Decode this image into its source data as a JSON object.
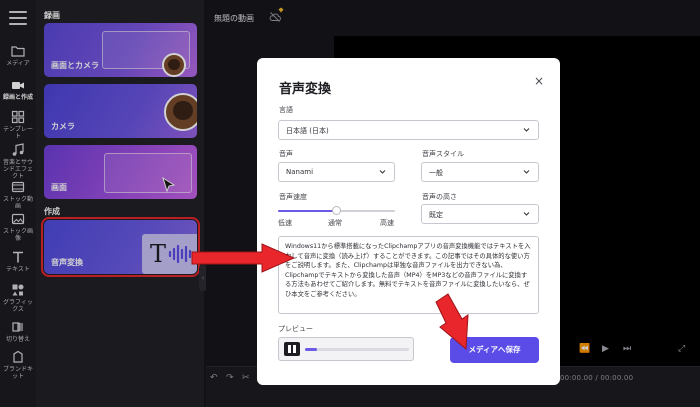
{
  "rail": {
    "items": [
      {
        "label": "メディア"
      },
      {
        "label": "録画と作成"
      },
      {
        "label": "テンプレー\nト"
      },
      {
        "label": "音楽とサウ\nンドエフェ\nクト"
      },
      {
        "label": "ストック動\n画"
      },
      {
        "label": "ストック画\n像"
      },
      {
        "label": "テキスト"
      },
      {
        "label": "グラフィッ\nクス"
      },
      {
        "label": "切り替え"
      },
      {
        "label": "ブランドキ\nット"
      }
    ]
  },
  "panel": {
    "section_record": "録画",
    "section_create": "作成",
    "cards": [
      {
        "label": "画面とカメラ"
      },
      {
        "label": "カメラ"
      },
      {
        "label": "画面"
      },
      {
        "label": "音声変換"
      }
    ]
  },
  "editor": {
    "project_title": "無題の動画",
    "timecode": "00:00.00 / 00:00.00"
  },
  "modal": {
    "title": "音声変換",
    "close": "×",
    "language_label": "言語",
    "language_value": "日本語 (日本)",
    "voice_label": "音声",
    "voice_value": "Nanami",
    "style_label": "音声スタイル",
    "style_value": "一般",
    "speed_label": "音声速度",
    "speed_ticks": [
      "低速",
      "通常",
      "高速"
    ],
    "speed_level": 0.5,
    "pitch_label": "音声の高さ",
    "pitch_value": "既定",
    "text": "Windows11から標準搭載になったClipchampアプリの音声変換機能ではテキストを入力して音声に変換（読み上げ）することができます。この記事ではその具体的な使い方をご説明します。また、Clipchampは単独な音声ファイルを出力できない為、Clipchampでテキストから変換した音声（MP4）をMP3などの音声ファイルに変換する方法もあわせてご紹介します。無料でテキストを音声ファイルに変換したいなら、ぜひ本文をご参考ください。",
    "preview_label": "プレビュー",
    "preview_progress": 0.12,
    "save_button": "メディアへ保存"
  },
  "colors": {
    "accent": "#5b4ce8",
    "highlight": "#e3262c",
    "arrow": "#e8262b"
  },
  "icons": [
    "menu-icon",
    "folder-icon",
    "video-camera-icon",
    "template-icon",
    "music-icon",
    "film-icon",
    "image-icon",
    "text-icon",
    "shapes-icon",
    "transition-icon",
    "brand-icon",
    "cloud-off-icon",
    "gem-icon",
    "close-icon",
    "chevron-down-icon",
    "pause-icon",
    "undo-icon",
    "redo-icon",
    "scissors-icon",
    "play-icon",
    "skip-icon",
    "fullscreen-icon"
  ]
}
